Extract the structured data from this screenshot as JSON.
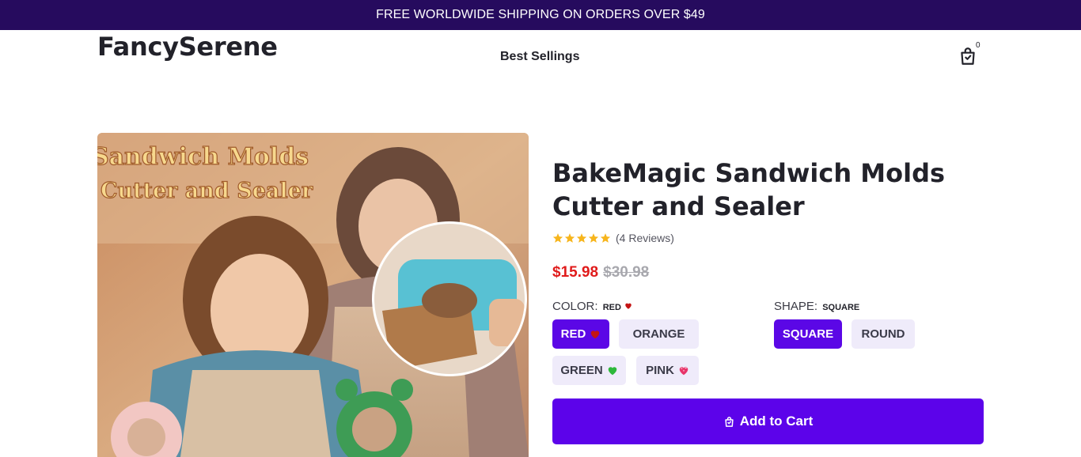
{
  "announcement": "FREE WORLDWIDE SHIPPING ON ORDERS OVER $49",
  "header": {
    "logo": "FancySerene",
    "nav": [
      "Best Sellings"
    ],
    "cart_count": "0"
  },
  "product": {
    "image_text_line1": "Sandwich Molds",
    "image_text_line2": "Cutter and Sealer",
    "title": "BakeMagic Sandwich Molds Cutter and Sealer",
    "rating": 5,
    "reviews": "(4 Reviews)",
    "price": "$15.98",
    "compare_price": "$30.98",
    "color": {
      "label": "COLOR:",
      "selected": "RED",
      "options": [
        {
          "label": "RED",
          "emoji": "heart-red",
          "active": true
        },
        {
          "label": "ORANGE",
          "emoji": "",
          "active": false
        },
        {
          "label": "GREEN",
          "emoji": "heart-green",
          "active": false
        },
        {
          "label": "PINK",
          "emoji": "heart-pink",
          "active": false
        }
      ]
    },
    "shape": {
      "label": "SHAPE:",
      "selected": "SQUARE",
      "options": [
        {
          "label": "SQUARE",
          "active": true
        },
        {
          "label": "ROUND",
          "active": false
        }
      ]
    },
    "add_to_cart": "Add to Cart"
  },
  "colors": {
    "accent": "#5c03ea",
    "announce_bg": "#260b5e",
    "sale_price": "#e01b1b"
  }
}
